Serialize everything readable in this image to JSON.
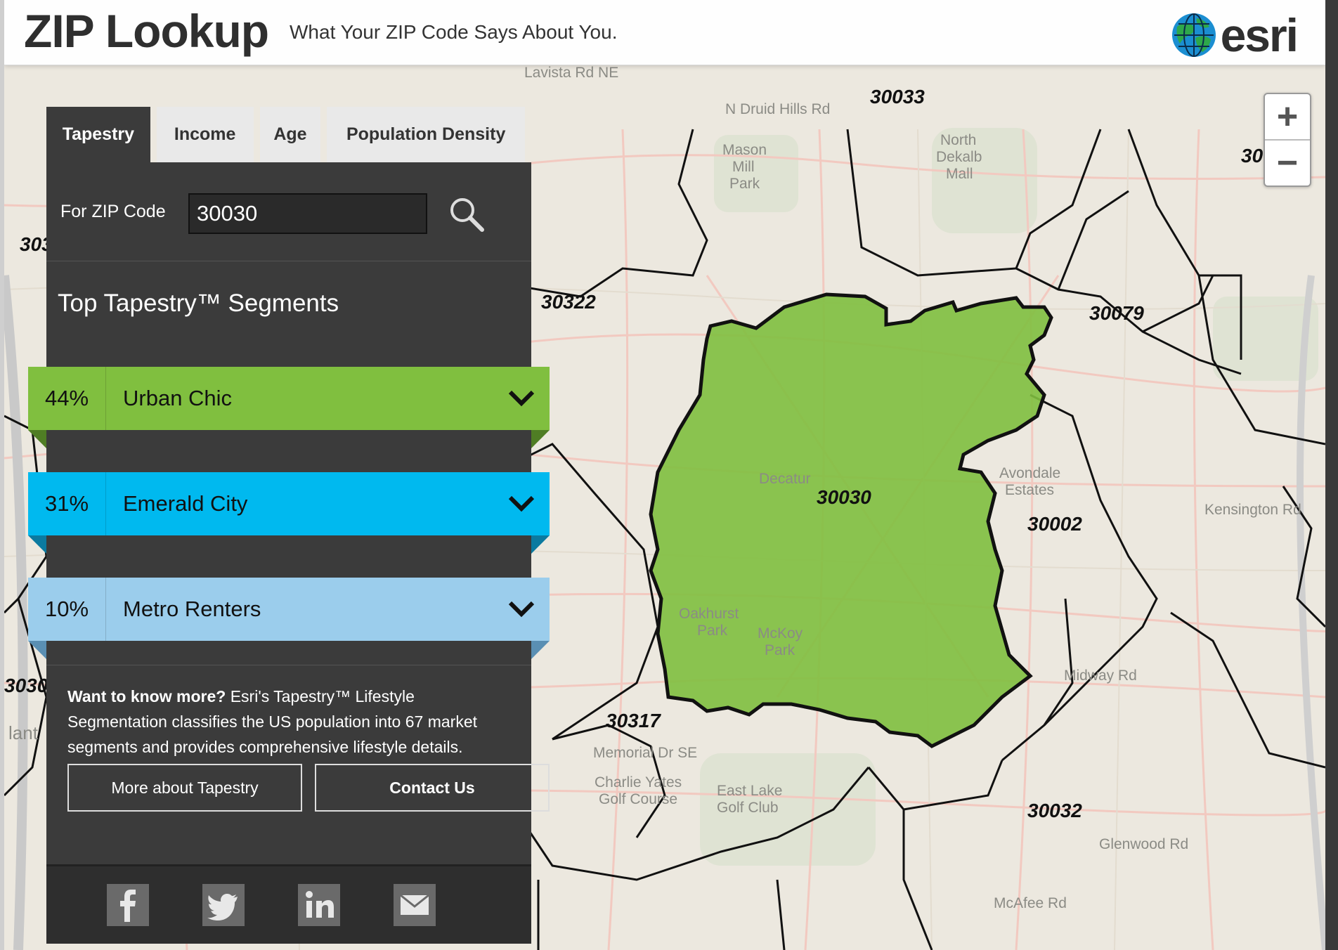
{
  "header": {
    "title": "ZIP Lookup",
    "tagline": "What Your ZIP Code Says About You.",
    "logo_text": "esri"
  },
  "tabs": [
    {
      "label": "Tapestry",
      "active": true
    },
    {
      "label": "Income",
      "active": false
    },
    {
      "label": "Age",
      "active": false
    },
    {
      "label": "Population Density",
      "active": false
    }
  ],
  "search": {
    "label": "For ZIP Code",
    "value": "30030",
    "icon": "search-icon"
  },
  "segments": {
    "title": "Top Tapestry™ Segments",
    "items": [
      {
        "pct": "44%",
        "name": "Urban Chic",
        "color": "#80bf3f",
        "fold": "#4f7d24"
      },
      {
        "pct": "31%",
        "name": "Emerald City",
        "color": "#00b9ef",
        "fold": "#0b7aa0"
      },
      {
        "pct": "10%",
        "name": "Metro Renters",
        "color": "#9bcdec",
        "fold": "#5a8fb3"
      }
    ]
  },
  "more_info": {
    "lead": "Want to know more?",
    "text": " Esri's Tapestry™ Lifestyle Segmentation classifies the US population into 67 market segments and provides comprehensive lifestyle details.",
    "btn_tapestry": "More about Tapestry",
    "btn_contact": "Contact Us"
  },
  "social": [
    "facebook-icon",
    "twitter-icon",
    "linkedin-icon",
    "email-icon"
  ],
  "zoom": {
    "in": "+",
    "out": "−"
  },
  "map": {
    "highlight_color": "#80bf3f",
    "zip_labels": {
      "z30033": "30033",
      "z30322": "30322",
      "z30079": "30079",
      "z30030": "30030",
      "z30002": "30002",
      "z30317": "30317",
      "z30032": "30032",
      "z303a": "303",
      "z303b": "3030",
      "z30c": "30"
    },
    "place_labels": {
      "decatur": "Decatur",
      "avondale": "Avondale",
      "estates": "Estates",
      "mason": "Mason",
      "mill": "Mill",
      "park": "Park",
      "north": "North",
      "dekalb": "Dekalb",
      "mall": "Mall",
      "midway": "Midway Rd",
      "memorial": "Memorial Dr SE",
      "glenwood": "Glenwood Rd",
      "charlie": "Charlie Yates",
      "golfcourse": "Golf Course",
      "eastlake": "East Lake",
      "golfclub": "Golf Club",
      "mcafee": "McAfee Rd",
      "kensington": "Kensington Rd",
      "ndruid": "N Druid Hills Rd",
      "lavista": "Lavista Rd NE",
      "oakhurst": "Oakhurst",
      "oakpark": "Park",
      "mckoy": "McKoy",
      "mckpark": "Park",
      "atlanta": "lant"
    }
  }
}
